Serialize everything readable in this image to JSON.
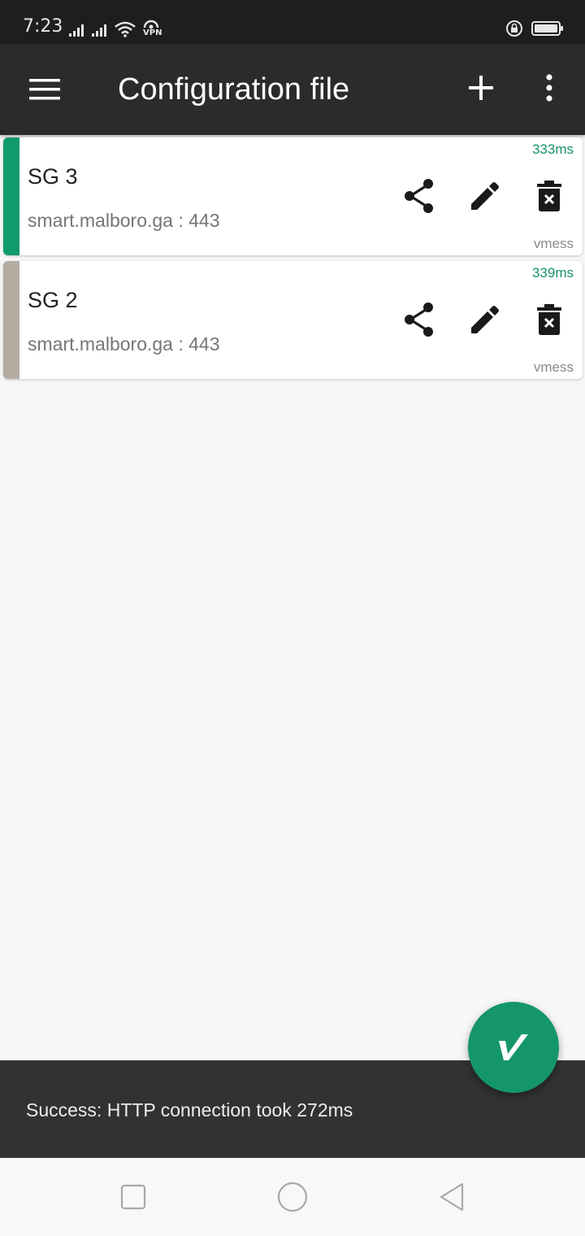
{
  "status_bar": {
    "time": "7:23",
    "vpn_label": "VPN",
    "icons": [
      "signal-icon",
      "signal-icon",
      "wifi-icon",
      "vpn-icon",
      "lock-rotation-icon",
      "battery-icon"
    ]
  },
  "toolbar": {
    "title": "Configuration file",
    "menu_icon": "menu-icon",
    "add_icon": "add-icon",
    "more_icon": "more-vert-icon"
  },
  "servers": [
    {
      "name": "SG 3",
      "address": "smart.malboro.ga : 443",
      "latency": "333ms",
      "type": "vmess",
      "selected": true,
      "stripe_color": "#119a6c"
    },
    {
      "name": "SG 2",
      "address": "smart.malboro.ga : 443",
      "latency": "339ms",
      "type": "vmess",
      "selected": false,
      "stripe_color": "#b3aca1"
    }
  ],
  "snackbar": {
    "message": "Success: HTTP connection took 272ms"
  },
  "fab": {
    "icon": "v2ray-logo-icon",
    "color": "#159669"
  },
  "nav_bar": {
    "icons": [
      "recent-apps-icon",
      "home-icon",
      "back-icon"
    ]
  },
  "colors": {
    "toolbar": "#2b2b2b",
    "accent": "#159669",
    "latency_text": "#15936b"
  }
}
